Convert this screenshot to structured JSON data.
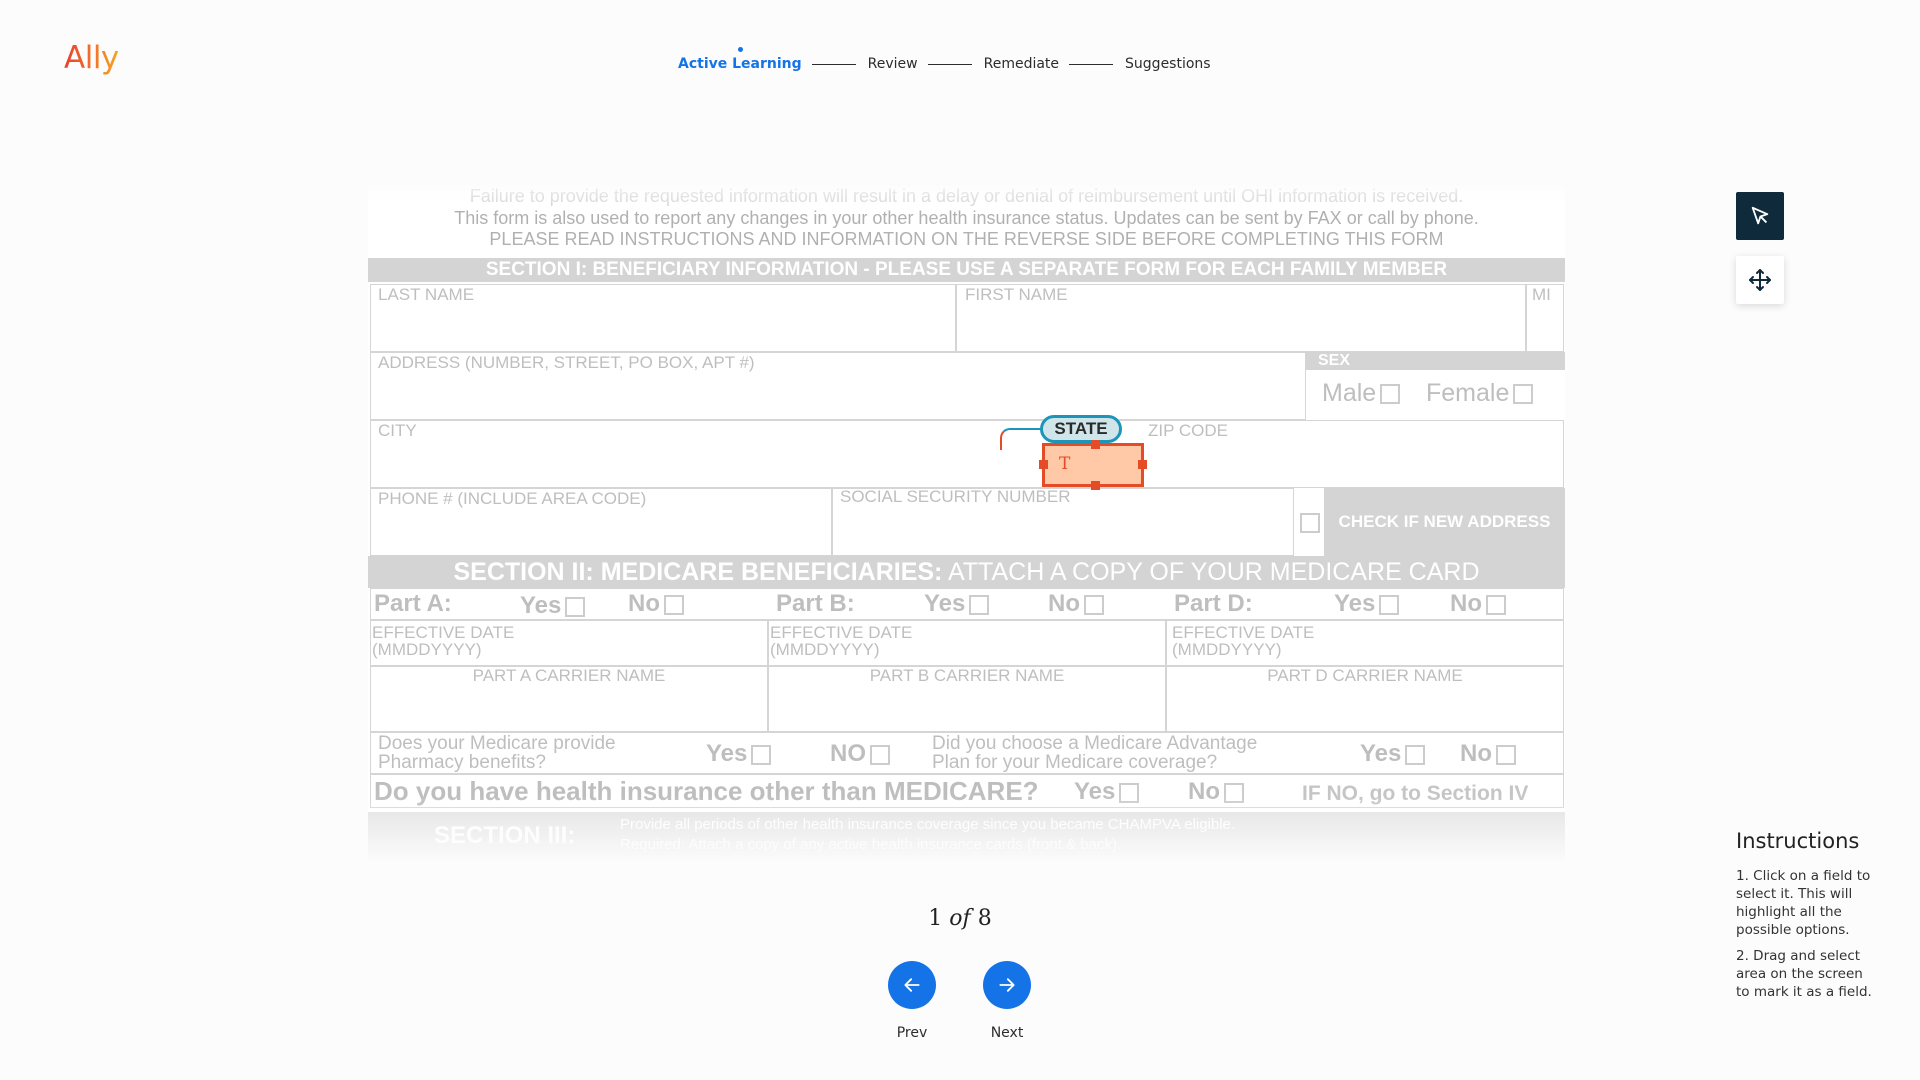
{
  "app": {
    "logo": "Ally"
  },
  "stepper": {
    "steps": [
      {
        "label": "Active Learning",
        "active": true
      },
      {
        "label": "Review",
        "active": false
      },
      {
        "label": "Remediate",
        "active": false
      },
      {
        "label": "Suggestions",
        "active": false
      }
    ]
  },
  "document": {
    "notice_top": "Failure to provide the requested information will result in a delay or denial of reimbursement until OHI information is received.",
    "notice_line2": "This form is also used to report any changes in your other health insurance status. Updates can be sent by FAX or call by phone.",
    "notice_line3": "PLEASE READ INSTRUCTIONS AND INFORMATION ON THE REVERSE SIDE BEFORE COMPLETING THIS FORM",
    "section1_title": "SECTION I: BENEFICIARY INFORMATION - PLEASE USE A SEPARATE FORM FOR EACH FAMILY MEMBER",
    "last_name": "LAST NAME",
    "first_name": "FIRST NAME",
    "mi": "MI",
    "address": "ADDRESS (NUMBER, STREET, PO BOX, APT #)",
    "sex": "SEX",
    "male": "Male",
    "female": "Female",
    "city": "CITY",
    "state": "STATE",
    "zip": "ZIP CODE",
    "phone": "PHONE # (INCLUDE AREA CODE)",
    "ssn": "SOCIAL SECURITY NUMBER",
    "new_address": "CHECK IF NEW ADDRESS",
    "section2_bold": "SECTION II: MEDICARE BENEFICIARIES:",
    "section2_rest": " ATTACH A COPY OF YOUR MEDICARE CARD",
    "part_a": "Part A:",
    "part_b": "Part B:",
    "part_d": "Part D:",
    "yes": "Yes",
    "no": "No",
    "no_caps": "NO",
    "effective_date_1": "EFFECTIVE DATE",
    "effective_date_2": "(MMDDYYYY)",
    "part_a_carrier": "PART A CARRIER NAME",
    "part_b_carrier": "PART B CARRIER NAME",
    "part_d_carrier": "PART D CARRIER NAME",
    "pharmacy_q1": "Does your Medicare provide",
    "pharmacy_q2": "Pharmacy benefits?",
    "advantage_q1": "Did you choose a Medicare Advantage",
    "advantage_q2": "Plan for your Medicare coverage?",
    "other_insurance_q": "Do you have health insurance other than MEDICARE?",
    "if_no": "IF NO, go to Section IV",
    "section3_title": "SECTION III:",
    "section3_text1": "Provide all periods of other health insurance coverage since you became CHAMPVA eligible.",
    "section3_text2": "Required: Attach a copy of any active health insurance cards (front & back)."
  },
  "annotation": {
    "chip_label": "STATE",
    "field_type_glyph": "T"
  },
  "tools": [
    {
      "icon": "select-pointer-icon",
      "active": true
    },
    {
      "icon": "move-icon",
      "active": false
    }
  ],
  "pager": {
    "current": "1",
    "of": "of",
    "total": "8"
  },
  "nav": {
    "prev_label": "Prev",
    "next_label": "Next"
  },
  "instructions": {
    "title": "Instructions",
    "items": [
      "1. Click on a field to select it. This will highlight all the possible options.",
      "2. Drag and select area on the screen to mark it as a field."
    ]
  },
  "colors": {
    "accent": "#1473e6",
    "field_highlight": "#e34c26",
    "chip_border": "#1c95b8",
    "tool_dark": "#0f2a3a"
  }
}
